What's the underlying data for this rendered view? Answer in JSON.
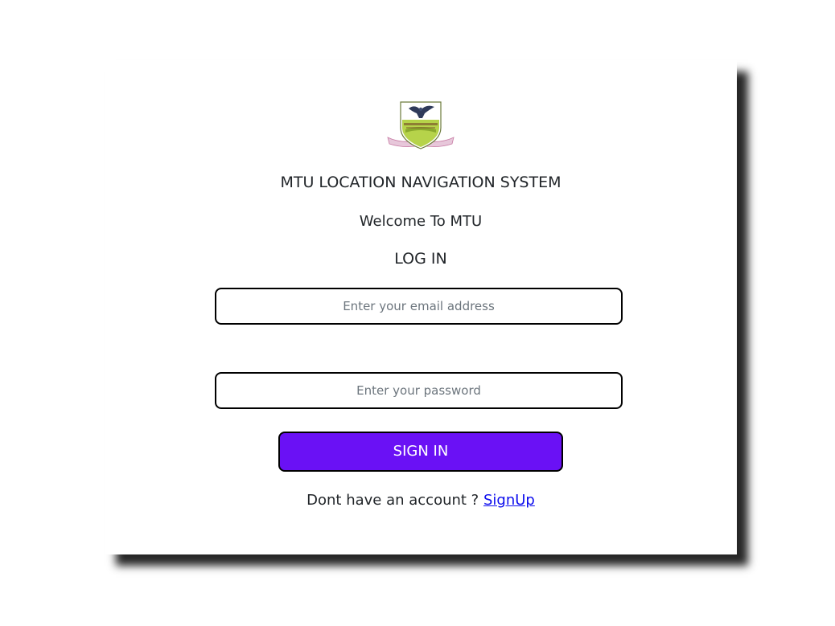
{
  "app": {
    "title": "MTU LOCATION NAVIGATION SYSTEM",
    "welcome": "Welcome To MTU",
    "login_heading": "LOG IN"
  },
  "logo": {
    "icon": "university-crest-eagle-shield"
  },
  "form": {
    "email": {
      "value": "",
      "placeholder": "Enter your email address"
    },
    "password": {
      "value": "",
      "placeholder": "Enter your password"
    },
    "sign_in_label": "SIGN IN",
    "sign_in_color": "#6a11f5"
  },
  "signup": {
    "prompt": "Dont have an account ?",
    "link_label": "SignUp",
    "link_color": "#0d0dee"
  }
}
